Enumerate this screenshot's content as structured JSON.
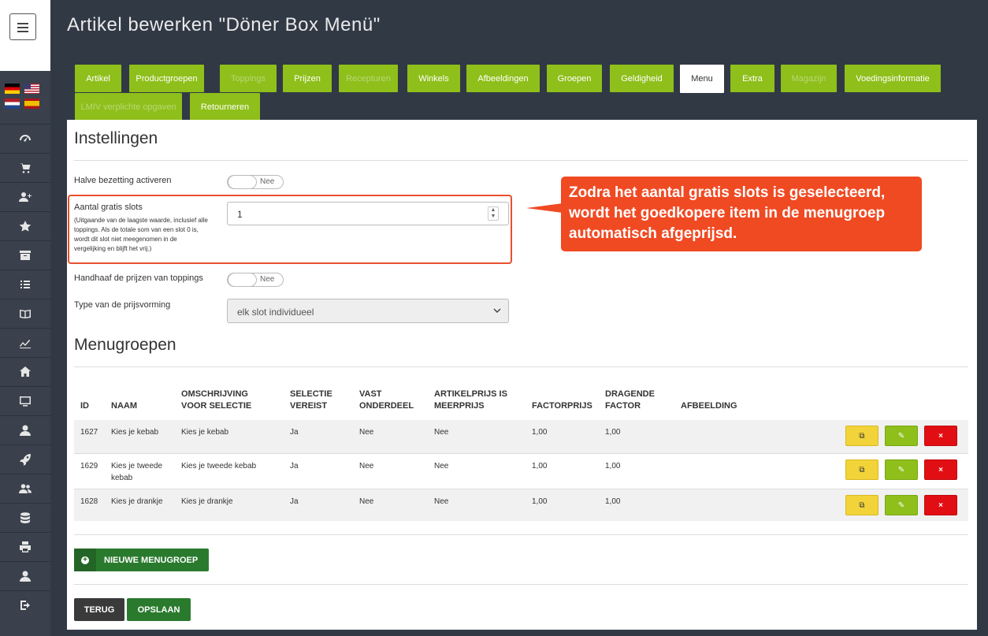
{
  "header": {
    "title": "Artikel bewerken \"Döner Box Menü\""
  },
  "tabs": [
    {
      "label": "Artikel",
      "state": "normal"
    },
    {
      "label": "Productgroepen",
      "state": "normal"
    },
    {
      "label": "Toppings",
      "state": "disabled"
    },
    {
      "label": "Prijzen",
      "state": "normal"
    },
    {
      "label": "Recepturen",
      "state": "disabled"
    },
    {
      "label": "Winkels",
      "state": "normal"
    },
    {
      "label": "Afbeeldingen",
      "state": "normal"
    },
    {
      "label": "Groepen",
      "state": "normal"
    },
    {
      "label": "Geldigheid",
      "state": "normal"
    },
    {
      "label": "Menu",
      "state": "active"
    },
    {
      "label": "Extra",
      "state": "normal"
    },
    {
      "label": "Magazijn",
      "state": "disabled"
    },
    {
      "label": "Voedingsinformatie",
      "state": "normal"
    },
    {
      "label": "LMIV verplichte opgaven",
      "state": "disabled"
    },
    {
      "label": "Retourneren",
      "state": "normal"
    }
  ],
  "settings": {
    "title": "Instellingen",
    "half_occupancy": {
      "label": "Halve bezetting activeren",
      "toggle": "Nee"
    },
    "free_slots": {
      "label": "Aantal gratis slots",
      "help": "(Uitgaande van de laagste waarde, inclusief alle toppings. Als de totale som van een slot 0 is, wordt dit slot niet meegenomen in de vergelijking en blijft het vrij.)",
      "value": "1"
    },
    "keep_topping_prices": {
      "label": "Handhaaf de prijzen van toppings",
      "toggle": "Nee"
    },
    "pricing_type": {
      "label": "Type van de prijsvorming",
      "value": "elk slot individueel"
    }
  },
  "callout": {
    "text": "Zodra het aantal gratis slots is geselecteerd, wordt het goedkopere item in de menugroep automatisch afgeprijsd."
  },
  "menugroups": {
    "title": "Menugroepen",
    "columns": [
      "ID",
      "NAAM",
      "OMSCHRIJVING VOOR SELECTIE",
      "SELECTIE VEREIST",
      "VAST ONDERDEEL",
      "ARTIKELPRIJS IS MEERPRIJS",
      "FACTORPRIJS",
      "DRAGENDE FACTOR",
      "AFBEELDING"
    ],
    "rows": [
      {
        "id": "1627",
        "name": "Kies je kebab",
        "desc": "Kies je kebab",
        "required": "Ja",
        "fixed": "Nee",
        "surcharge": "Nee",
        "factor_price": "1,00",
        "carrying": "1,00"
      },
      {
        "id": "1629",
        "name": "Kies je tweede kebab",
        "desc": "Kies je tweede kebab",
        "required": "Ja",
        "fixed": "Nee",
        "surcharge": "Nee",
        "factor_price": "1,00",
        "carrying": "1,00"
      },
      {
        "id": "1628",
        "name": "Kies je drankje",
        "desc": "Kies je drankje",
        "required": "Ja",
        "fixed": "Nee",
        "surcharge": "Nee",
        "factor_price": "1,00",
        "carrying": "1,00"
      }
    ]
  },
  "buttons": {
    "new_group": "NIEUWE MENUGROEP",
    "back": "TERUG",
    "save": "OPSLAAN"
  },
  "icons": {
    "sidebar": [
      "dashboard-icon",
      "cart-icon",
      "add-user-icon",
      "star-icon",
      "archive-icon",
      "list-icon",
      "book-icon",
      "chart-icon",
      "home-icon",
      "monitor-icon",
      "user-icon",
      "rocket-icon",
      "users-icon",
      "database-icon",
      "print-icon",
      "account-icon",
      "logout-icon"
    ]
  },
  "colors": {
    "accent": "#8fbf1a",
    "callout": "#f04a23",
    "primary": "#2a7a2e",
    "danger": "#e10f13",
    "warning": "#f3d33a"
  }
}
